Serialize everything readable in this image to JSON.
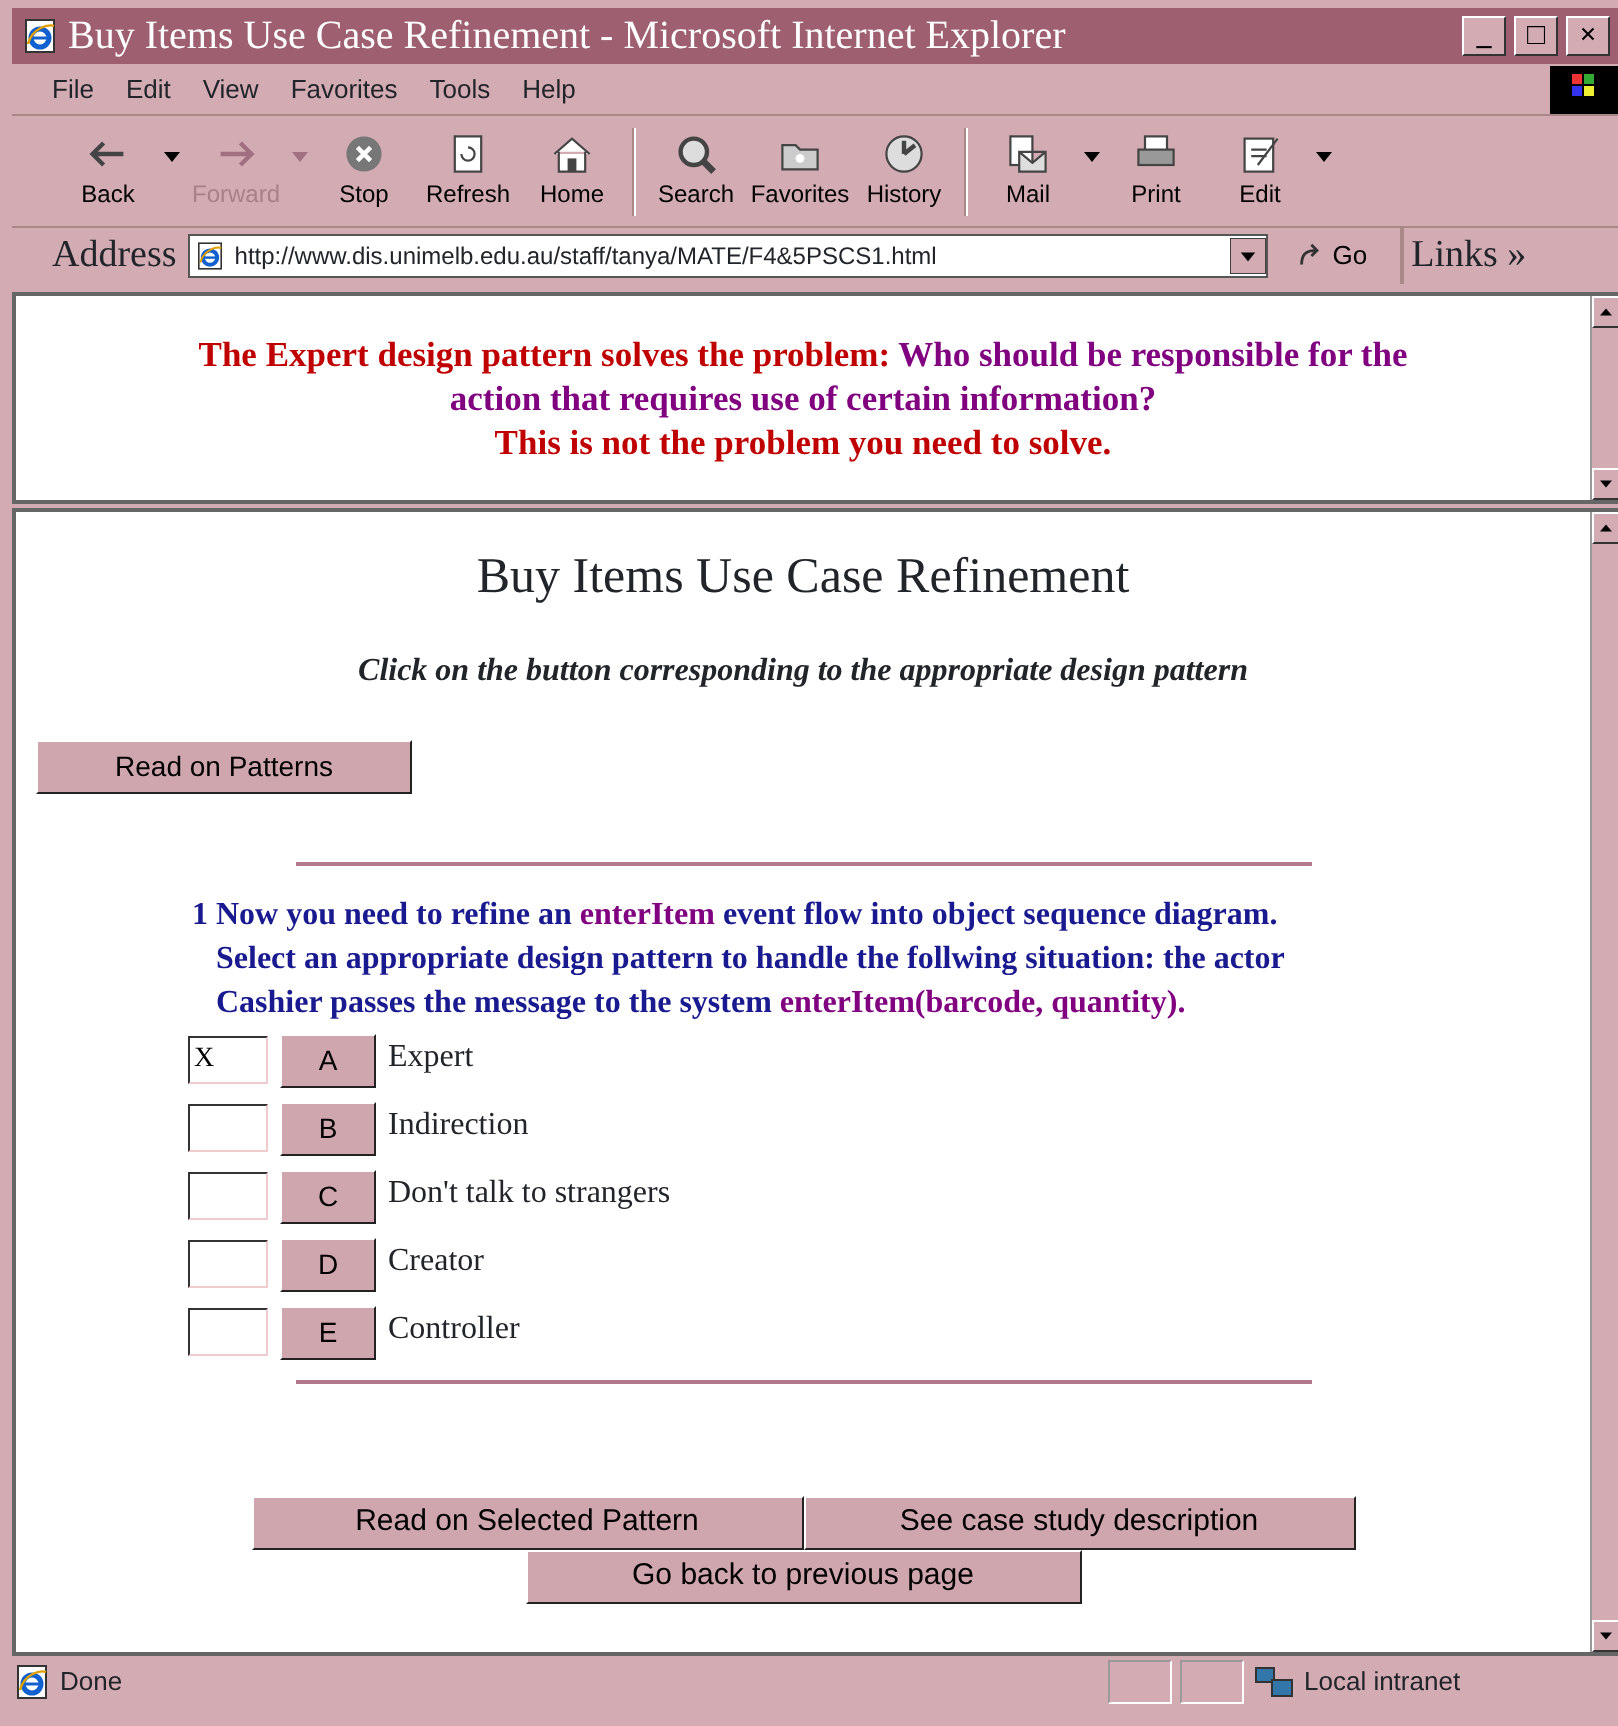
{
  "window": {
    "title": "Buy Items Use Case Refinement - Microsoft Internet Explorer",
    "controls": [
      "_",
      "□",
      "×"
    ]
  },
  "menu": [
    "File",
    "Edit",
    "View",
    "Favorites",
    "Tools",
    "Help"
  ],
  "toolbar": [
    {
      "label": "Back",
      "kind": "back",
      "disabled": false,
      "dropdown": true
    },
    {
      "label": "Forward",
      "kind": "forward",
      "disabled": true,
      "dropdown": true
    },
    {
      "label": "Stop",
      "kind": "stop",
      "disabled": false,
      "dropdown": false
    },
    {
      "label": "Refresh",
      "kind": "refresh",
      "disabled": false,
      "dropdown": false
    },
    {
      "label": "Home",
      "kind": "home",
      "disabled": false,
      "dropdown": false
    },
    {
      "label": "Search",
      "kind": "search",
      "disabled": false,
      "dropdown": false
    },
    {
      "label": "Favorites",
      "kind": "favorites",
      "disabled": false,
      "dropdown": false
    },
    {
      "label": "History",
      "kind": "history",
      "disabled": false,
      "dropdown": false
    },
    {
      "label": "Mail",
      "kind": "mail",
      "disabled": false,
      "dropdown": true
    },
    {
      "label": "Print",
      "kind": "print",
      "disabled": false,
      "dropdown": false
    },
    {
      "label": "Edit",
      "kind": "edit",
      "disabled": false,
      "dropdown": true
    }
  ],
  "address_bar": {
    "label": "Address",
    "url": "http://www.dis.unimelb.edu.au/staff/tanya/MATE/F4&5PSCS1.html",
    "go": "Go",
    "links": "Links »"
  },
  "feedback_frame": {
    "lines": [
      [
        {
          "text": "The Expert design pattern solves the problem: ",
          "kind": "plain"
        },
        {
          "text": "Who should be responsible for the",
          "kind": "highlight"
        }
      ],
      [
        {
          "text": "action that requires use of certain information?",
          "kind": "highlight"
        }
      ],
      [
        {
          "text": "This is not the problem you need to solve.",
          "kind": "plain"
        }
      ]
    ]
  },
  "main_frame": {
    "heading": "Buy Items Use Case Refinement",
    "instruction": "Click on the button corresponding to the appropriate design pattern",
    "read_button": "Read on Patterns",
    "question": {
      "number": "1",
      "lines": [
        [
          {
            "text": "Now you need to refine an ",
            "kind": "plain"
          },
          {
            "text": "enterItem",
            "kind": "highlight"
          },
          {
            "text": " event flow into object sequence diagram.",
            "kind": "plain"
          }
        ],
        [
          {
            "text": "Select an appropriate design pattern to handle the follwing situation: the actor",
            "kind": "plain"
          }
        ],
        [
          {
            "text": "Cashier passes the message to the system ",
            "kind": "plain"
          },
          {
            "text": "enterItem(barcode, quantity).",
            "kind": "highlight"
          }
        ]
      ],
      "options": [
        {
          "answer": "X",
          "letter": "A",
          "label": "Expert"
        },
        {
          "letter": "B",
          "label": "Indirection"
        },
        {
          "letter": "C",
          "label": "Don't talk to strangers"
        },
        {
          "letter": "D",
          "label": "Creator"
        },
        {
          "letter": "E",
          "label": "Controller"
        }
      ]
    },
    "bottom_buttons": [
      [
        "Read on Selected Pattern",
        "See case study description"
      ],
      [
        "Go back to previous page"
      ]
    ]
  },
  "status_bar": {
    "text": "Done",
    "zone": "Local intranet"
  }
}
